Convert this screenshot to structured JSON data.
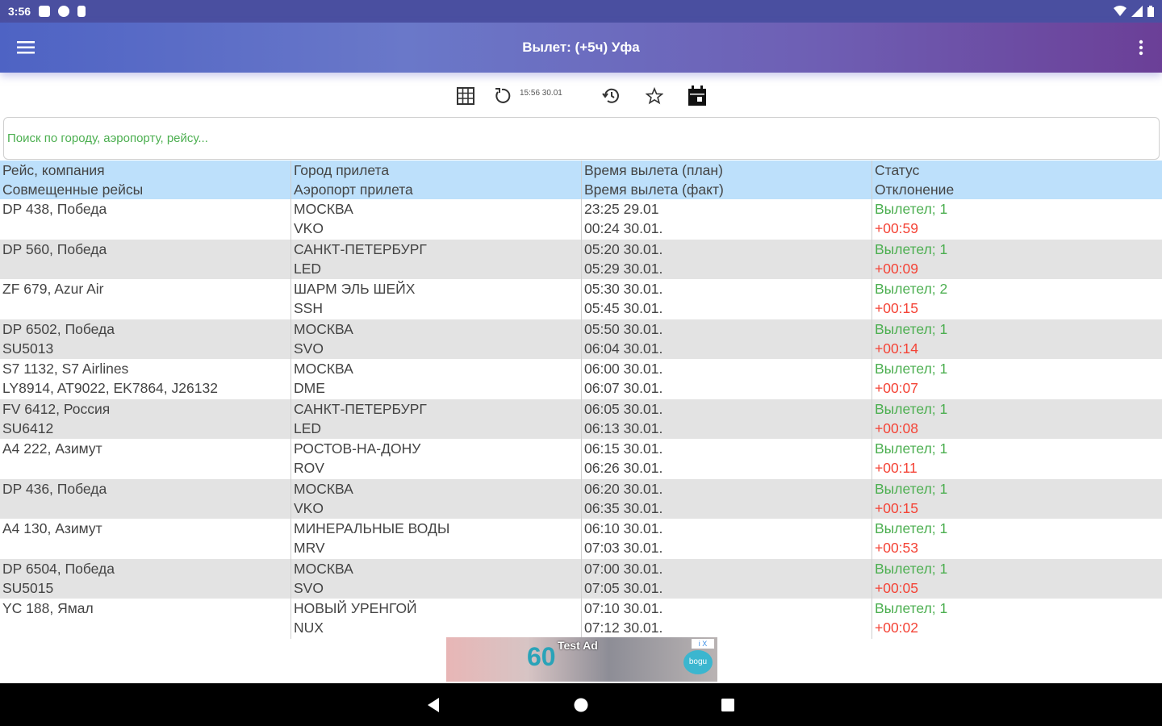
{
  "status_bar": {
    "time": "3:56",
    "icons": [
      "sim-icon",
      "p-icon",
      "storage-icon"
    ],
    "right_icons": [
      "wifi-icon",
      "signal-icon",
      "battery-icon"
    ]
  },
  "app_bar": {
    "title": "Вылет: (+5ч) Уфа",
    "menu_icon": "hamburger-menu-icon",
    "more_icon": "more-vert-icon"
  },
  "toolbar": {
    "icons": [
      "grid-icon",
      "refresh-icon",
      "history-icon",
      "star-icon",
      "calendar-icon"
    ],
    "updated_time": "15:56 30.01"
  },
  "search": {
    "placeholder": "Поиск по городу, аэропорту, рейсу...",
    "value": ""
  },
  "table": {
    "headers": [
      [
        "Рейс, компания",
        "Совмещенные рейсы"
      ],
      [
        "Город прилета",
        "Аэропорт прилета"
      ],
      [
        "Время вылета (план)",
        "Время вылета (факт)"
      ],
      [
        "Статус",
        "Отклонение"
      ]
    ],
    "rows": [
      {
        "flight": "DP 438, Победа",
        "codeshare": "",
        "city": "МОСКВА",
        "airport": "VKO",
        "plan": "23:25 29.01",
        "fact": "00:24 30.01.",
        "status": "Вылетел;  1",
        "deviation": "+00:59"
      },
      {
        "flight": "DP 560, Победа",
        "codeshare": "",
        "city": "САНКТ-ПЕТЕРБУРГ",
        "airport": "LED",
        "plan": "05:20 30.01.",
        "fact": "05:29 30.01.",
        "status": "Вылетел;  1",
        "deviation": "+00:09"
      },
      {
        "flight": "ZF 679, Azur Air",
        "codeshare": "",
        "city": "ШАРМ ЭЛЬ ШЕЙХ",
        "airport": "SSH",
        "plan": "05:30 30.01.",
        "fact": "05:45 30.01.",
        "status": "Вылетел;  2",
        "deviation": "+00:15"
      },
      {
        "flight": "DP 6502, Победа",
        "codeshare": "SU5013",
        "city": "МОСКВА",
        "airport": "SVO",
        "plan": "05:50 30.01.",
        "fact": "06:04 30.01.",
        "status": "Вылетел;  1",
        "deviation": "+00:14"
      },
      {
        "flight": "S7 1132, S7 Airlines",
        "codeshare": "LY8914, AT9022, EK7864, J26132",
        "city": "МОСКВА",
        "airport": "DME",
        "plan": "06:00 30.01.",
        "fact": "06:07 30.01.",
        "status": "Вылетел;  1",
        "deviation": "+00:07"
      },
      {
        "flight": "FV 6412, Россия",
        "codeshare": "SU6412",
        "city": "САНКТ-ПЕТЕРБУРГ",
        "airport": "LED",
        "plan": "06:05 30.01.",
        "fact": "06:13 30.01.",
        "status": "Вылетел;  1",
        "deviation": "+00:08"
      },
      {
        "flight": "A4 222, Азимут",
        "codeshare": "",
        "city": "РОСТОВ-НА-ДОНУ",
        "airport": "ROV",
        "plan": "06:15 30.01.",
        "fact": "06:26 30.01.",
        "status": "Вылетел;  1",
        "deviation": "+00:11"
      },
      {
        "flight": "DP 436, Победа",
        "codeshare": "",
        "city": "МОСКВА",
        "airport": "VKO",
        "plan": "06:20 30.01.",
        "fact": "06:35 30.01.",
        "status": "Вылетел;  1",
        "deviation": "+00:15"
      },
      {
        "flight": "A4 130, Азимут",
        "codeshare": "",
        "city": "МИНЕРАЛЬНЫЕ ВОДЫ",
        "airport": "MRV",
        "plan": "06:10 30.01.",
        "fact": "07:03 30.01.",
        "status": "Вылетел;  1",
        "deviation": "+00:53"
      },
      {
        "flight": "DP 6504, Победа",
        "codeshare": "SU5015",
        "city": "МОСКВА",
        "airport": "SVO",
        "plan": "07:00 30.01.",
        "fact": "07:05 30.01.",
        "status": "Вылетел;  1",
        "deviation": "+00:05"
      },
      {
        "flight": "YC 188, Ямал",
        "codeshare": "",
        "city": "НОВЫЙ УРЕНГОЙ",
        "airport": "NUX",
        "plan": "07:10 30.01.",
        "fact": "07:12 30.01.",
        "status": "Вылетел;  1",
        "deviation": "+00:02"
      }
    ]
  },
  "ad": {
    "label": "Test Ad",
    "big_text": "60",
    "logo_text": "bogu",
    "close_text": "i X"
  },
  "nav_bar": {
    "buttons": [
      "back-icon",
      "home-icon",
      "recents-icon"
    ]
  },
  "colors": {
    "status_ok": "#4caf50",
    "deviation": "#f44336",
    "header_bg": "#bde0fb",
    "alt_row_bg": "#e3e3e3"
  }
}
